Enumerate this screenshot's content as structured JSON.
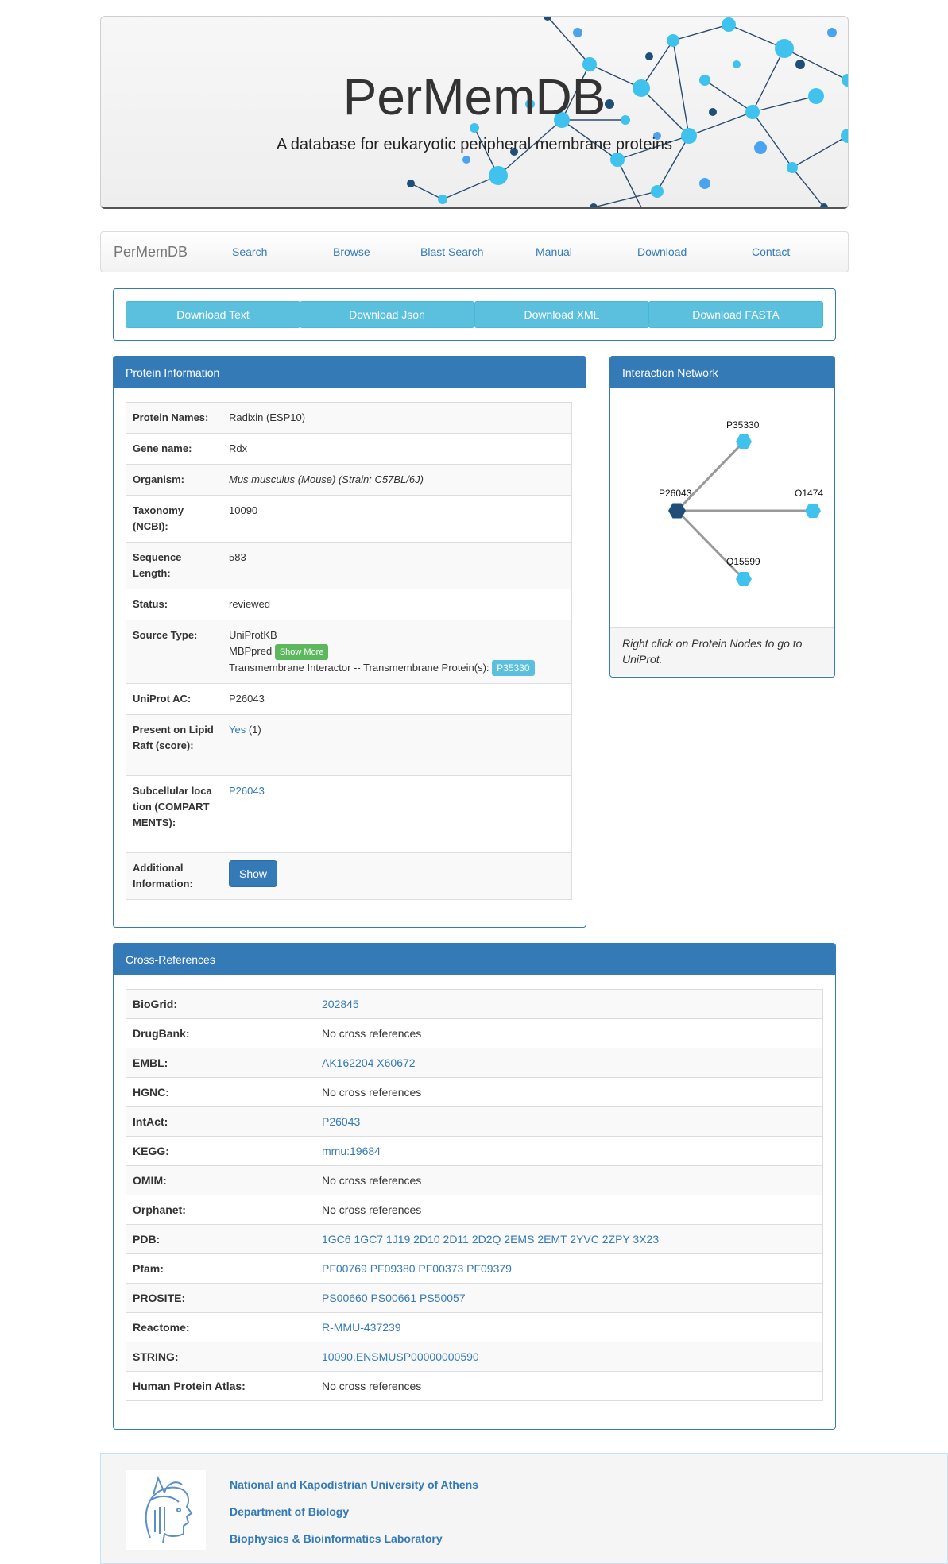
{
  "banner": {
    "title": "PerMemDB",
    "subtitle": "A database for eukaryotic peripheral membrane proteins"
  },
  "navbar": {
    "brand": "PerMemDB",
    "items": [
      "Search",
      "Browse",
      "Blast Search",
      "Manual",
      "Download",
      "Contact"
    ]
  },
  "downloads": [
    "Download Text",
    "Download Json",
    "Download XML",
    "Download FASTA"
  ],
  "protein_info": {
    "heading": "Protein Information",
    "rows": {
      "names_label": "Protein Names:",
      "names_value": "Radixin (ESP10)",
      "gene_label": "Gene name:",
      "gene_value": "Rdx",
      "organism_label": "Organism:",
      "organism_value": "Mus musculus (Mouse) (Strain: C57BL/6J)",
      "taxonomy_label": "Taxonomy (NCBI):",
      "taxonomy_value": "10090",
      "seqlen_label": "Sequence Length:",
      "seqlen_value": "583",
      "status_label": "Status:",
      "status_value": "reviewed",
      "source_label": "Source Type:",
      "source_line1": "UniProtKB",
      "source_line2": "MBPpred",
      "show_more": "Show More",
      "source_line3": "Transmembrane Interactor -- Transmembrane Protein(s):",
      "source_badge": "P35330",
      "uniprot_label": "UniProt AC:",
      "uniprot_value": "P26043",
      "raft_label": "Present on Lipid Raft (score):",
      "raft_link": "Yes",
      "raft_score": "(1)",
      "subcell_label": "Subcellular location (COMPARTMENTS):",
      "subcell_link": "P26043",
      "additional_label": "Additional Information:",
      "show_button": "Show"
    }
  },
  "network": {
    "heading": "Interaction Network",
    "nodes": [
      "P26043",
      "P35330",
      "O1474",
      "Q15599"
    ],
    "footer": "Right click on Protein Nodes to go to UniProt."
  },
  "cross_refs": {
    "heading": "Cross-References",
    "rows": [
      {
        "key": "BioGrid:",
        "value": "202845"
      },
      {
        "key": "DrugBank:",
        "value": "No cross references"
      },
      {
        "key": "EMBL:",
        "value": "AK162204 X60672"
      },
      {
        "key": "HGNC:",
        "value": "No cross references"
      },
      {
        "key": "IntAct:",
        "value": "P26043"
      },
      {
        "key": "KEGG:",
        "value": "mmu:19684"
      },
      {
        "key": "OMIM:",
        "value": "No cross references"
      },
      {
        "key": "Orphanet:",
        "value": "No cross references"
      },
      {
        "key": "PDB:",
        "value": "1GC6 1GC7 1J19 2D10 2D11 2D2Q 2EMS 2EMT 2YVC 2ZPY 3X23"
      },
      {
        "key": "Pfam:",
        "value": "PF00769 PF09380 PF00373 PF09379"
      },
      {
        "key": "PROSITE:",
        "value": "PS00660 PS00661 PS50057"
      },
      {
        "key": "Reactome:",
        "value": "R-MMU-437239"
      },
      {
        "key": "STRING:",
        "value": "10090.ENSMUSP00000000590"
      },
      {
        "key": "Human Protein Atlas:",
        "value": "No cross references"
      }
    ]
  },
  "footer": {
    "lines": [
      "National and Kapodistrian University of Athens",
      "Department of Biology",
      "Biophysics & Bioinformatics Laboratory"
    ]
  },
  "colors": {
    "primary": "#337ab7",
    "info": "#5bc0de",
    "success": "#5cb85c",
    "node_dark": "#1f4e79",
    "node_light": "#3fc3ee"
  }
}
